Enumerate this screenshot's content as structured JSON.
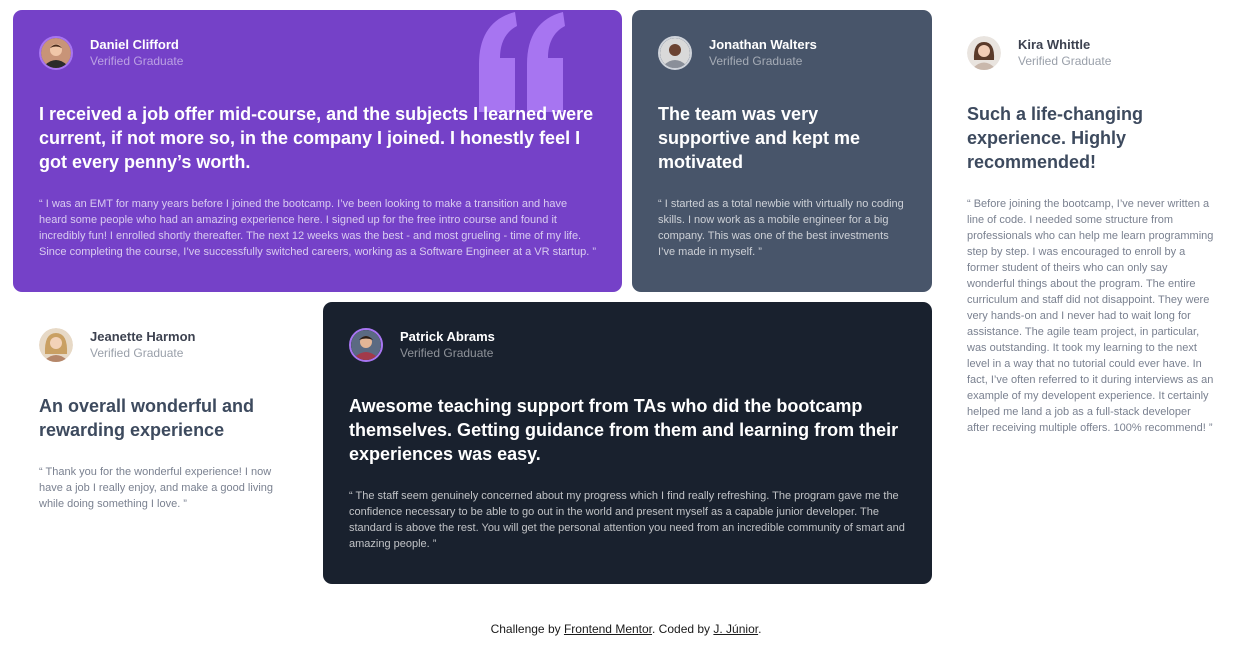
{
  "testimonials": [
    {
      "name": "Daniel Clifford",
      "role": "Verified Graduate",
      "title": "I received a job offer mid-course, and the subjects I learned were current, if not more so, in the company I joined. I honestly feel I got every penny’s worth.",
      "body": "“ I was an EMT for many years before I joined the bootcamp. I’ve been looking to make a transition and have heard some people who had an amazing experience here. I signed up for the free intro course and found it incredibly fun! I enrolled shortly thereafter. The next 12 weeks was the best - and most grueling - time of my life. Since completing the course, I’ve successfully switched careers, working as a Software Engineer at a VR startup. ”",
      "avatar_icon": "person-avatar-icon",
      "card_color": "#7541c8"
    },
    {
      "name": "Jonathan Walters",
      "role": "Verified Graduate",
      "title": "The team was very supportive and kept me motivated",
      "body": "“ I started as a total newbie with virtually no coding skills. I now work as a mobile engineer for a big company. This was one of the best investments I’ve made in myself. ”",
      "avatar_icon": "person-avatar-icon",
      "card_color": "#48556a"
    },
    {
      "name": "Kira Whittle",
      "role": "Verified Graduate",
      "title": "Such a life-changing experience. Highly recommended!",
      "body": "“ Before joining the bootcamp, I’ve never written a line of code. I needed some structure from professionals who can help me learn programming step by step. I was encouraged to enroll by a former student of theirs who can only say wonderful things about the program. The entire curriculum and staff did not disappoint. They were very hands-on and I never had to wait long for assistance. The agile team project, in particular, was outstanding. It took my learning to the next level in a way that no tutorial could ever have. In fact, I’ve often referred to it during interviews as an example of my developent experience. It certainly helped me land a job as a full-stack developer after receiving multiple offers. 100% recommend! ”",
      "avatar_icon": "person-avatar-icon",
      "card_color": "#ffffff"
    },
    {
      "name": "Jeanette Harmon",
      "role": "Verified Graduate",
      "title": "An overall wonderful and rewarding experience",
      "body": "“ Thank you for the wonderful experience! I now have a job I really enjoy, and make a good living while doing something I love. ”",
      "avatar_icon": "person-avatar-icon",
      "card_color": "#ffffff"
    },
    {
      "name": "Patrick Abrams",
      "role": "Verified Graduate",
      "title": "Awesome teaching support from TAs who did the bootcamp themselves. Getting guidance from them and learning from their experiences was easy.",
      "body": "“ The staff seem genuinely concerned about my progress which I find really refreshing. The program gave me the confidence necessary to be able to go out in the world and present myself as a capable junior developer. The standard is above the rest. You will get the personal attention you need from an incredible community of smart and amazing people. ”",
      "avatar_icon": "person-avatar-icon",
      "card_color": "#19212e"
    }
  ],
  "decoration": {
    "quote_icon": "quotation-mark-icon",
    "quote_color": "#a775f1"
  },
  "footer": {
    "prefix": "Challenge by ",
    "link1": "Frontend Mentor",
    "middle": ". Coded by ",
    "link2": "J. Júnior",
    "suffix": "."
  }
}
